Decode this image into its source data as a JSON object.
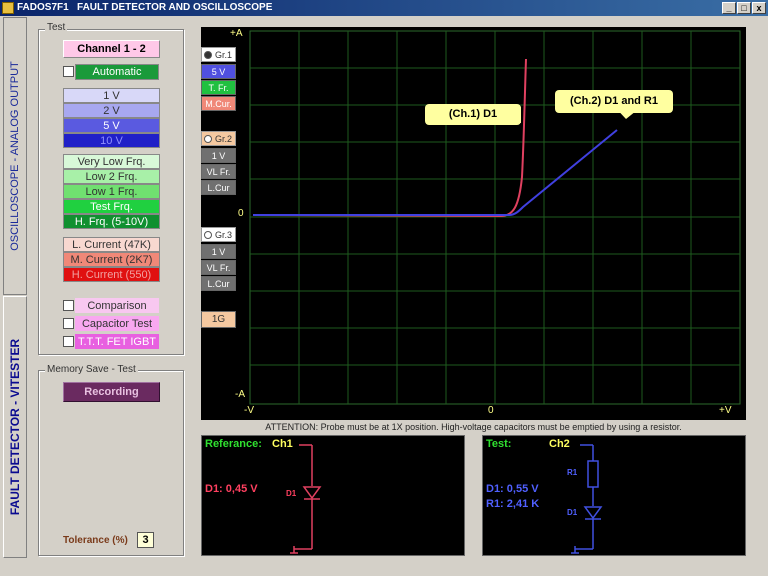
{
  "window": {
    "title": "FADOS7F1   FAULT DETECTOR AND OSCILLOSCOPE",
    "btn_min": "_",
    "btn_max": "□",
    "btn_close": "x"
  },
  "tabs": {
    "oscilloscope": "OSCILLOSCOPE - ANALOG OUTPUT",
    "fault": "FAULT DETECTOR - VITESTER"
  },
  "test_group": {
    "label": "Test",
    "channel_button": "Channel 1 - 2",
    "automatic_label": "Automatic",
    "voltages": [
      "1 V",
      "2 V",
      "5 V",
      "10 V"
    ],
    "frequencies": [
      "Very Low Frq.",
      "Low 2 Frq.",
      "Low 1 Frq.",
      "Test Frq.",
      "H. Frq. (5-10V)"
    ],
    "currents": [
      "L. Current (47K)",
      "M. Current (2K7)",
      "H. Current (550)"
    ],
    "comparison_label": "Comparison",
    "capacitor_label": "Capacitor Test",
    "transistor_label": "T.T.T. FET  IGBT"
  },
  "memory_group": {
    "label": "Memory Save - Test",
    "recording_button": "Recording"
  },
  "tolerance": {
    "label": "Tolerance (%)",
    "value": "3"
  },
  "screen_side": {
    "gr1": {
      "label": "Gr.1",
      "volt": "5 V",
      "freq": "T. Fr.",
      "cur": "M.Cur."
    },
    "gr2": {
      "label": "Gr.2",
      "volt": "1 V",
      "freq": "VL Fr.",
      "cur": "L.Cur"
    },
    "gr3": {
      "label": "Gr.3",
      "volt": "1 V",
      "freq": "VL Fr.",
      "cur": "L.Cur"
    },
    "gain": "1G"
  },
  "scope": {
    "y_top": "+A",
    "y_zero": "0",
    "y_bottom": "-A",
    "x_left": "-V",
    "x_zero": "0",
    "x_right": "+V",
    "callout_ch1": "(Ch.1)  D1",
    "callout_ch2": "(Ch.2) D1 and R1",
    "trace_colors": {
      "ch1": "#e04060",
      "ch2": "#4040e0"
    }
  },
  "attention": "ATTENTION: Probe must be at 1X position. High-voltage capacitors must be emptied by using a resistor.",
  "reference_panel": {
    "title": "Referance:",
    "channel": "Ch1",
    "measure": "D1: 0,45 V",
    "component": "D1"
  },
  "test_panel": {
    "title": "Test:",
    "channel": "Ch2",
    "measure_d1": "D1: 0,55 V",
    "measure_r1": "R1: 2,41 K",
    "component_r": "R1",
    "component_d": "D1"
  }
}
